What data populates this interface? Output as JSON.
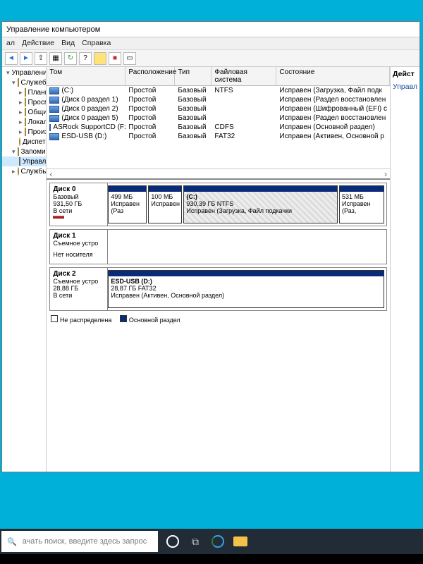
{
  "window": {
    "title": "Управление компьютером",
    "menu": {
      "file": "ал",
      "action": "Действие",
      "view": "Вид",
      "help": "Справка"
    }
  },
  "tree": {
    "root": "Управление компьютером (л",
    "group_sys": "Служебные программы",
    "task_sched": "Планировщик заданий",
    "event_vwr": "Просмотр событий",
    "shared": "Общие папки",
    "local_users": "Локальные пользовател",
    "perf": "Производительность",
    "devmgr": "Диспетчер устройств",
    "storage": "Запоминающие устройст",
    "diskmgmt": "Управление дисками",
    "services": "Службы и приложения"
  },
  "columns": {
    "vol": "Том",
    "lay": "Расположение",
    "typ": "Тип",
    "fs": "Файловая система",
    "stat": "Состояние"
  },
  "volumes": [
    {
      "name": "(C:)",
      "layout": "Простой",
      "type": "Базовый",
      "fs": "NTFS",
      "status": "Исправен (Загрузка, Файл подк"
    },
    {
      "name": "(Диск 0 раздел 1)",
      "layout": "Простой",
      "type": "Базовый",
      "fs": "",
      "status": "Исправен (Раздел восстановлен"
    },
    {
      "name": "(Диск 0 раздел 2)",
      "layout": "Простой",
      "type": "Базовый",
      "fs": "",
      "status": "Исправен (Шифрованный (EFI) с"
    },
    {
      "name": "(Диск 0 раздел 5)",
      "layout": "Простой",
      "type": "Базовый",
      "fs": "",
      "status": "Исправен (Раздел восстановлен"
    },
    {
      "name": "ASRock SupportCD (F:)",
      "layout": "Простой",
      "type": "Базовый",
      "fs": "CDFS",
      "status": "Исправен (Основной раздел)"
    },
    {
      "name": "ESD-USB (D:)",
      "layout": "Простой",
      "type": "Базовый",
      "fs": "FAT32",
      "status": "Исправен (Активен, Основной р"
    }
  ],
  "disks": {
    "d0": {
      "name": "Диск 0",
      "type": "Базовый",
      "size": "931,50 ГБ",
      "status": "В сети",
      "p1": {
        "size": "499 МБ",
        "status": "Исправен (Раз"
      },
      "p2": {
        "size": "100 МБ",
        "status": "Исправен"
      },
      "p3": {
        "label": "(C:)",
        "size": "930,39 ГБ NTFS",
        "status": "Исправен (Загрузка, Файл подкачки"
      },
      "p4": {
        "size": "531 МБ",
        "status": "Исправен (Раз,"
      }
    },
    "d1": {
      "name": "Диск 1",
      "type": "Съемное устро",
      "status": "Нет носителя"
    },
    "d2": {
      "name": "Диск 2",
      "type": "Съемное устро",
      "size": "28,88 ГБ",
      "status": "В сети",
      "p1": {
        "label": "ESD-USB (D:)",
        "size": "28,87 ГБ FAT32",
        "status": "Исправен (Активен, Основной раздел)"
      }
    }
  },
  "legend": {
    "unalloc": "Не распределена",
    "primary": "Основной раздел"
  },
  "actions": {
    "title": "Дейст",
    "link": "Управл"
  },
  "taskbar": {
    "search_placeholder": "ачать поиск, введите здесь запрос"
  }
}
